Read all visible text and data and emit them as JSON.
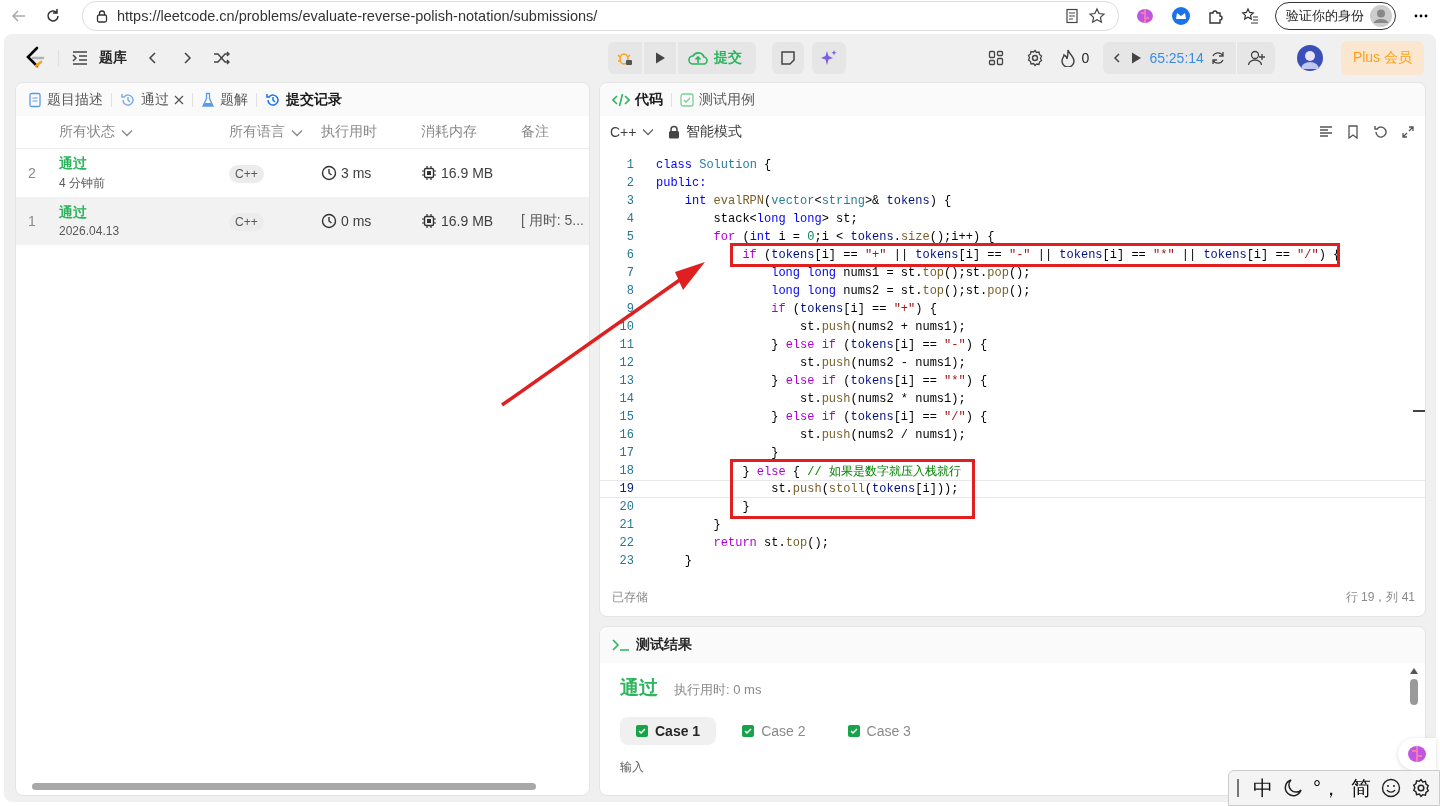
{
  "browser": {
    "url": "https://leetcode.cn/problems/evaluate-reverse-polish-notation/submissions/",
    "profile_label": "验证你的身份"
  },
  "header": {
    "nav_label": "题库",
    "submit_label": "提交",
    "streak": "0",
    "timer": "65:25:14",
    "plus_label": "Plus 会员"
  },
  "left_panel": {
    "tabs": [
      {
        "kind": "doc",
        "label": "题目描述",
        "selected": false,
        "closable": false
      },
      {
        "kind": "history",
        "label": "通过",
        "selected": false,
        "closable": true
      },
      {
        "kind": "flask",
        "label": "题解",
        "selected": false,
        "closable": false
      },
      {
        "kind": "history",
        "label": "提交记录",
        "selected": true,
        "closable": false
      }
    ],
    "columns": [
      {
        "label": "所有状态",
        "dropdown": true
      },
      {
        "label": "所有语言",
        "dropdown": true
      },
      {
        "label": "执行用时",
        "dropdown": false
      },
      {
        "label": "消耗内存",
        "dropdown": false
      },
      {
        "label": "备注",
        "dropdown": false
      }
    ],
    "rows": [
      {
        "index": "2",
        "status": "通过",
        "submitted": "4 分钟前",
        "language": "C++",
        "runtime": "3 ms",
        "memory": "16.9 MB",
        "selected": false
      },
      {
        "index": "1",
        "status": "通过",
        "submitted": "2026.04.13",
        "language": "C++",
        "runtime": "0 ms",
        "memory": "16.9 MB",
        "note": "[ 用时: 5...",
        "selected": true
      }
    ]
  },
  "editor": {
    "tabs": [
      {
        "kind": "code",
        "label": "代码",
        "selected": true
      },
      {
        "kind": "check",
        "label": "测试用例",
        "selected": false
      }
    ],
    "language": "C++",
    "mode": "智能模式",
    "arrow": true,
    "lines": [
      {
        "number": "1",
        "marked": false,
        "current": false,
        "tokens": [
          {
            "kind": "kw",
            "text": "class "
          },
          {
            "kind": "type",
            "text": "Solution"
          },
          {
            "kind": "p",
            "text": " {"
          }
        ]
      },
      {
        "number": "2",
        "marked": false,
        "current": false,
        "tokens": [
          {
            "kind": "kw",
            "text": "public:"
          }
        ]
      },
      {
        "number": "3",
        "marked": false,
        "current": false,
        "tokens": [
          {
            "kind": "kw",
            "text": "    int "
          },
          {
            "kind": "fn",
            "text": "evalRPN"
          },
          {
            "kind": "p",
            "text": "("
          },
          {
            "kind": "type",
            "text": "vector"
          },
          {
            "kind": "p",
            "text": "<"
          },
          {
            "kind": "type",
            "text": "string"
          },
          {
            "kind": "p",
            "text": ">& "
          },
          {
            "kind": "var",
            "text": "tokens"
          },
          {
            "kind": "p",
            "text": ") {"
          }
        ]
      },
      {
        "number": "4",
        "marked": false,
        "current": false,
        "tokens": [
          {
            "kind": "p",
            "text": "        stack<"
          },
          {
            "kind": "kw",
            "text": "long long"
          },
          {
            "kind": "p",
            "text": "> st;"
          }
        ]
      },
      {
        "number": "5",
        "marked": false,
        "current": false,
        "tokens": [
          {
            "kind": "ctl",
            "text": "        for"
          },
          {
            "kind": "p",
            "text": " ("
          },
          {
            "kind": "kw",
            "text": "int"
          },
          {
            "kind": "p",
            "text": " i = "
          },
          {
            "kind": "num",
            "text": "0"
          },
          {
            "kind": "p",
            "text": ";i < "
          },
          {
            "kind": "var",
            "text": "tokens"
          },
          {
            "kind": "p",
            "text": "."
          },
          {
            "kind": "fn",
            "text": "size"
          },
          {
            "kind": "p",
            "text": "();i++) {"
          }
        ]
      },
      {
        "number": "6",
        "marked": true,
        "current": false,
        "tokens": [
          {
            "kind": "ctl",
            "text": "            if"
          },
          {
            "kind": "p",
            "text": " ("
          },
          {
            "kind": "var",
            "text": "tokens"
          },
          {
            "kind": "p",
            "text": "[i] == "
          },
          {
            "kind": "str",
            "text": "\"+\""
          },
          {
            "kind": "p",
            "text": " || "
          },
          {
            "kind": "var",
            "text": "tokens"
          },
          {
            "kind": "p",
            "text": "[i] == "
          },
          {
            "kind": "str",
            "text": "\"-\""
          },
          {
            "kind": "p",
            "text": " || "
          },
          {
            "kind": "var",
            "text": "tokens"
          },
          {
            "kind": "p",
            "text": "[i] == "
          },
          {
            "kind": "str",
            "text": "\"*\""
          },
          {
            "kind": "p",
            "text": " || "
          },
          {
            "kind": "var",
            "text": "tokens"
          },
          {
            "kind": "p",
            "text": "[i] == "
          },
          {
            "kind": "str",
            "text": "\"/\""
          },
          {
            "kind": "p",
            "text": ") {"
          }
        ]
      },
      {
        "number": "7",
        "marked": false,
        "current": false,
        "tokens": [
          {
            "kind": "kw",
            "text": "                long long"
          },
          {
            "kind": "p",
            "text": " nums1 = st."
          },
          {
            "kind": "fn",
            "text": "top"
          },
          {
            "kind": "p",
            "text": "();st."
          },
          {
            "kind": "fn",
            "text": "pop"
          },
          {
            "kind": "p",
            "text": "();"
          }
        ]
      },
      {
        "number": "8",
        "marked": false,
        "current": false,
        "tokens": [
          {
            "kind": "kw",
            "text": "                long long"
          },
          {
            "kind": "p",
            "text": " nums2 = st."
          },
          {
            "kind": "fn",
            "text": "top"
          },
          {
            "kind": "p",
            "text": "();st."
          },
          {
            "kind": "fn",
            "text": "pop"
          },
          {
            "kind": "p",
            "text": "();"
          }
        ]
      },
      {
        "number": "9",
        "marked": false,
        "current": false,
        "tokens": [
          {
            "kind": "ctl",
            "text": "                if"
          },
          {
            "kind": "p",
            "text": " ("
          },
          {
            "kind": "var",
            "text": "tokens"
          },
          {
            "kind": "p",
            "text": "[i] == "
          },
          {
            "kind": "str",
            "text": "\"+\""
          },
          {
            "kind": "p",
            "text": ") {"
          }
        ]
      },
      {
        "number": "10",
        "marked": false,
        "current": false,
        "tokens": [
          {
            "kind": "p",
            "text": "                    st."
          },
          {
            "kind": "fn",
            "text": "push"
          },
          {
            "kind": "p",
            "text": "(nums2 + nums1);"
          }
        ]
      },
      {
        "number": "11",
        "marked": false,
        "current": false,
        "tokens": [
          {
            "kind": "p",
            "text": "                } "
          },
          {
            "kind": "ctl",
            "text": "else if"
          },
          {
            "kind": "p",
            "text": " ("
          },
          {
            "kind": "var",
            "text": "tokens"
          },
          {
            "kind": "p",
            "text": "[i] == "
          },
          {
            "kind": "str",
            "text": "\"-\""
          },
          {
            "kind": "p",
            "text": ") {"
          }
        ]
      },
      {
        "number": "12",
        "marked": false,
        "current": false,
        "tokens": [
          {
            "kind": "p",
            "text": "                    st."
          },
          {
            "kind": "fn",
            "text": "push"
          },
          {
            "kind": "p",
            "text": "(nums2 - nums1);"
          }
        ]
      },
      {
        "number": "13",
        "marked": false,
        "current": false,
        "tokens": [
          {
            "kind": "p",
            "text": "                } "
          },
          {
            "kind": "ctl",
            "text": "else if"
          },
          {
            "kind": "p",
            "text": " ("
          },
          {
            "kind": "var",
            "text": "tokens"
          },
          {
            "kind": "p",
            "text": "[i] == "
          },
          {
            "kind": "str",
            "text": "\"*\""
          },
          {
            "kind": "p",
            "text": ") {"
          }
        ]
      },
      {
        "number": "14",
        "marked": false,
        "current": false,
        "tokens": [
          {
            "kind": "p",
            "text": "                    st."
          },
          {
            "kind": "fn",
            "text": "push"
          },
          {
            "kind": "p",
            "text": "(nums2 * nums1);"
          }
        ]
      },
      {
        "number": "15",
        "marked": false,
        "current": false,
        "tokens": [
          {
            "kind": "p",
            "text": "                } "
          },
          {
            "kind": "ctl",
            "text": "else if"
          },
          {
            "kind": "p",
            "text": " ("
          },
          {
            "kind": "var",
            "text": "tokens"
          },
          {
            "kind": "p",
            "text": "[i] == "
          },
          {
            "kind": "str",
            "text": "\"/\""
          },
          {
            "kind": "p",
            "text": ") {"
          }
        ]
      },
      {
        "number": "16",
        "marked": false,
        "current": false,
        "tokens": [
          {
            "kind": "p",
            "text": "                    st."
          },
          {
            "kind": "fn",
            "text": "push"
          },
          {
            "kind": "p",
            "text": "(nums2 / nums1);"
          }
        ]
      },
      {
        "number": "17",
        "marked": false,
        "current": false,
        "tokens": [
          {
            "kind": "p",
            "text": "                }"
          }
        ]
      },
      {
        "number": "18",
        "marked": true,
        "current": false,
        "tokens": [
          {
            "kind": "p",
            "text": "            } "
          },
          {
            "kind": "ctl",
            "text": "else"
          },
          {
            "kind": "p",
            "text": " { "
          },
          {
            "kind": "cm",
            "text": "// 如果是数字就压入栈就行"
          }
        ]
      },
      {
        "number": "19",
        "marked": true,
        "current": true,
        "tokens": [
          {
            "kind": "p",
            "text": "                st."
          },
          {
            "kind": "fn",
            "text": "push"
          },
          {
            "kind": "p",
            "text": "("
          },
          {
            "kind": "fn",
            "text": "stoll"
          },
          {
            "kind": "p",
            "text": "("
          },
          {
            "kind": "var",
            "text": "tokens"
          },
          {
            "kind": "p",
            "text": "[i]));"
          }
        ]
      },
      {
        "number": "20",
        "marked": true,
        "current": false,
        "tokens": [
          {
            "kind": "p",
            "text": "            }"
          }
        ]
      },
      {
        "number": "21",
        "marked": false,
        "current": false,
        "tokens": [
          {
            "kind": "p",
            "text": "        }"
          }
        ]
      },
      {
        "number": "22",
        "marked": false,
        "current": false,
        "tokens": [
          {
            "kind": "ctl",
            "text": "        return"
          },
          {
            "kind": "p",
            "text": " st."
          },
          {
            "kind": "fn",
            "text": "top"
          },
          {
            "kind": "p",
            "text": "();"
          }
        ]
      },
      {
        "number": "23",
        "marked": false,
        "current": false,
        "tokens": [
          {
            "kind": "p",
            "text": "    }"
          }
        ]
      }
    ],
    "saved": "已存储",
    "cursor": "行 19，列 41"
  },
  "results": {
    "title": "测试结果",
    "verdict": "通过",
    "runtime": "执行用时: 0 ms",
    "cases": [
      {
        "label": "Case 1",
        "checked": true,
        "selected": true
      },
      {
        "label": "Case 2",
        "checked": true,
        "selected": false
      },
      {
        "label": "Case 3",
        "checked": true,
        "selected": false
      }
    ],
    "input_label": "输入"
  },
  "ime": {
    "mode": "中",
    "punct": "°，",
    "script": "简"
  }
}
